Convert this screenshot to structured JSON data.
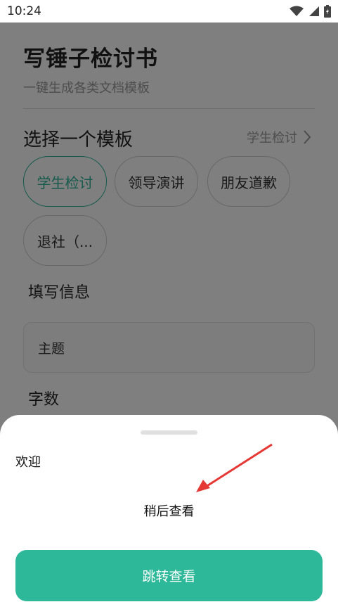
{
  "status_bar": {
    "time": "10:24",
    "icons": [
      "wifi-icon",
      "signal-icon",
      "battery-icon"
    ]
  },
  "header": {
    "title": "写锤子检讨书",
    "subtitle": "一键生成各类文档模板"
  },
  "template_section": {
    "title": "选择一个模板",
    "selected_link": "学生检讨",
    "chips": [
      {
        "label": "学生检讨",
        "active": true
      },
      {
        "label": "领导演讲",
        "active": false
      },
      {
        "label": "朋友道歉",
        "active": false
      },
      {
        "label": "退社（...",
        "active": false
      }
    ]
  },
  "form": {
    "section_title": "填写信息",
    "subject_placeholder": "主题",
    "word_count_label": "字数"
  },
  "sheet": {
    "welcome_text": "欢迎",
    "later_text": "稍后查看",
    "primary_button": "跳转查看"
  },
  "colors": {
    "accent": "#2eb89a",
    "overlay": "rgba(0,0,0,0.5)",
    "annotation_arrow": "#e53935"
  }
}
